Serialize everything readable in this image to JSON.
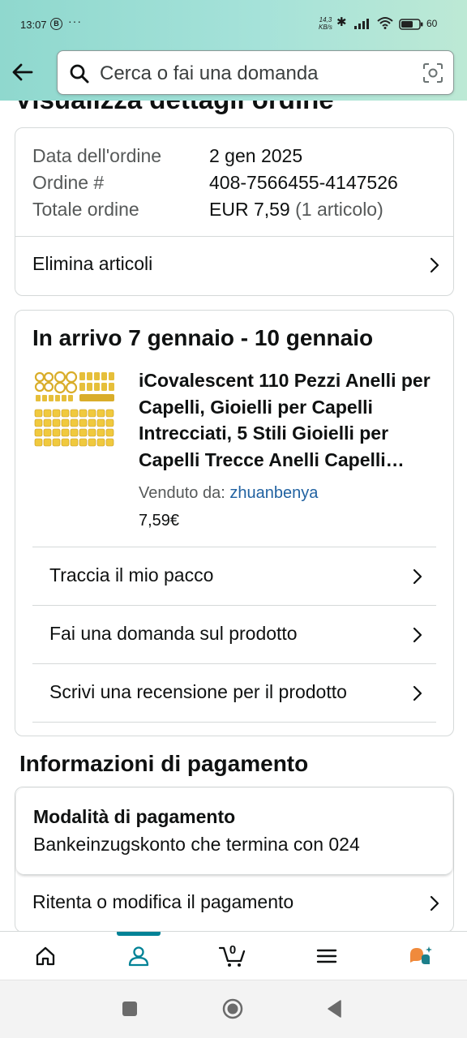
{
  "status_bar": {
    "time": "13:07",
    "b_badge": "B",
    "dots": "···",
    "speed_value": "14,3",
    "speed_unit": "KB/s",
    "battery": "60"
  },
  "header": {
    "search_placeholder": "Cerca o fai una domanda"
  },
  "page_title": "Visualizza dettagli ordine",
  "order_summary": {
    "date_label": "Data dell'ordine",
    "date_value": "2 gen 2025",
    "order_label": "Ordine #",
    "order_value": "408-7566455-4147526",
    "total_label": "Totale ordine",
    "total_value": "EUR 7,59",
    "total_items": "(1 articolo)",
    "delete_items": "Elimina articoli"
  },
  "shipment": {
    "delivery": "In arrivo 7 gennaio - 10 gennaio",
    "product_title": "iCovalescent 110 Pezzi Anelli per Capelli, Gioielli per Capelli Intrecciati, 5 Stili Gioielli per Capelli Trecce Anelli Capelli…",
    "seller_label": "Venduto da:",
    "seller_name": "zhuanbenya",
    "price": "7,59€",
    "actions": [
      {
        "label": "Traccia il mio pacco"
      },
      {
        "label": "Fai una domanda sul prodotto"
      },
      {
        "label": "Scrivi una recensione per il prodotto"
      }
    ]
  },
  "payment": {
    "section_title": "Informazioni di pagamento",
    "method_heading": "Modalità di pagamento",
    "method_value": "Bankeinzugskonto che termina con 024",
    "retry": "Ritenta o modifica il pagamento"
  },
  "bottom_nav": {
    "items": [
      "home-icon",
      "account-icon",
      "cart-icon",
      "menu-icon",
      "rufus-icon"
    ],
    "active": "account-icon",
    "cart_count": "0"
  },
  "colors": {
    "link": "#2162a1",
    "active_tab": "#008296",
    "rufus_orange": "#f08a3c",
    "rufus_teal": "#1c7f8a"
  }
}
